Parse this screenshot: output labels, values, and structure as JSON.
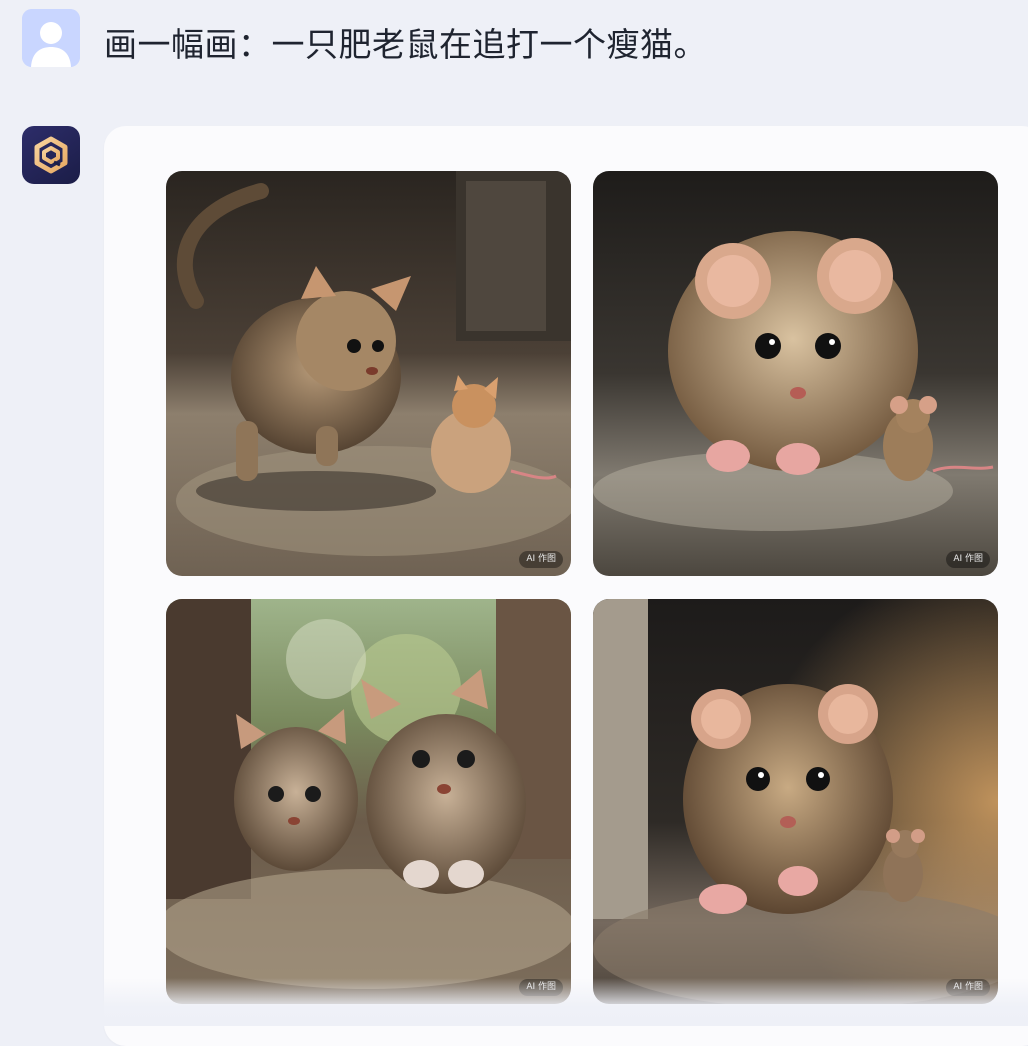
{
  "user_message": {
    "text": "画一幅画：一只肥老鼠在追打一个瘦猫。",
    "avatar_icon": "user-avatar-icon"
  },
  "assistant_message": {
    "avatar_icon": "assistant-logo-icon",
    "images": [
      {
        "badge": "AI 作图",
        "alt": "cat"
      },
      {
        "badge": "AI 作图",
        "alt": "mouse"
      },
      {
        "badge": "AI 作图",
        "alt": "cats"
      },
      {
        "badge": "AI 作图",
        "alt": "mouse"
      }
    ]
  },
  "colors": {
    "page_bg": "#eef0f7",
    "card_bg": "#fbfbfd",
    "user_avatar_bg": "#c9d6ff",
    "assistant_logo": "#f2c28a"
  }
}
